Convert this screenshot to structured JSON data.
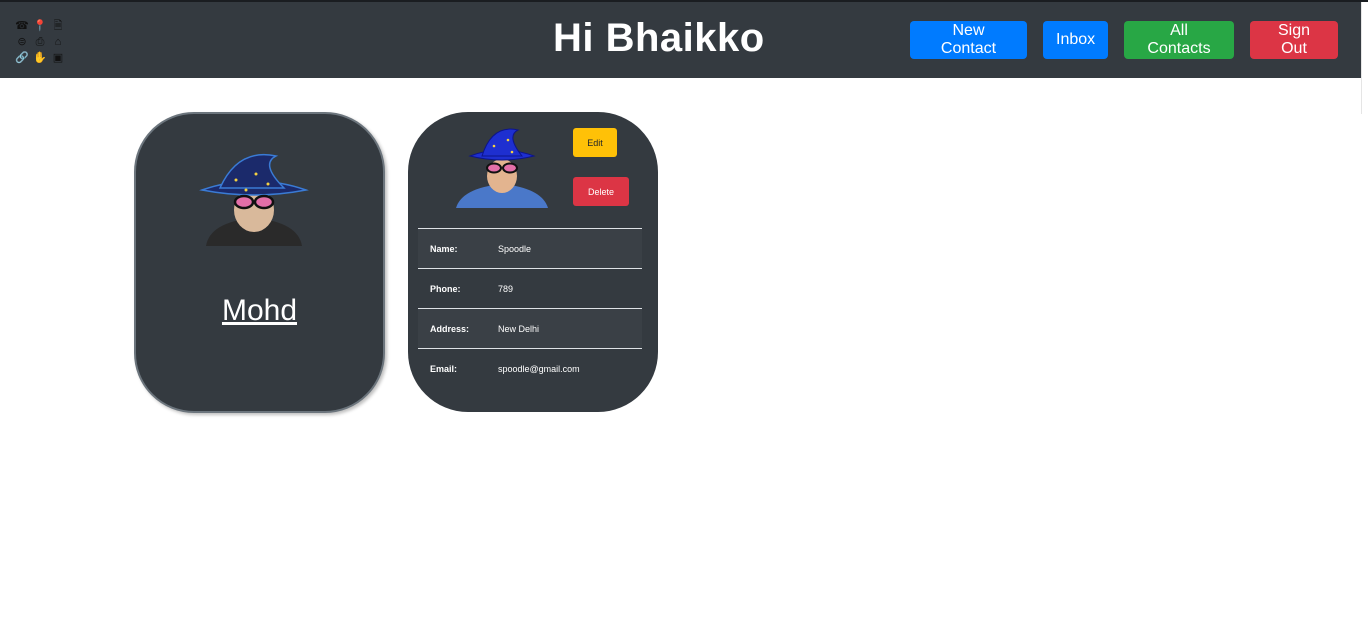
{
  "navbar": {
    "logo_icons": [
      "☎",
      "📍",
      "🗎",
      "⊜",
      "⎙",
      "⌂",
      "🔗",
      "✋",
      "▣"
    ],
    "title": "Hi Bhaikko",
    "buttons": {
      "new_contact": "New Contact",
      "inbox": "Inbox",
      "all_contacts": "All Contacts",
      "sign_out": "Sign Out"
    }
  },
  "profile_card": {
    "name": "Mohd"
  },
  "contact_card": {
    "edit_label": "Edit",
    "delete_label": "Delete",
    "fields": [
      {
        "label": "Name:",
        "value": "Spoodle"
      },
      {
        "label": "Phone:",
        "value": "789"
      },
      {
        "label": "Address:",
        "value": "New Delhi"
      },
      {
        "label": "Email:",
        "value": "spoodle@gmail.com"
      }
    ]
  },
  "colors": {
    "navbar_bg": "#343a40",
    "primary": "#007bff",
    "success": "#28a745",
    "danger": "#dc3545",
    "warning": "#ffc107"
  }
}
